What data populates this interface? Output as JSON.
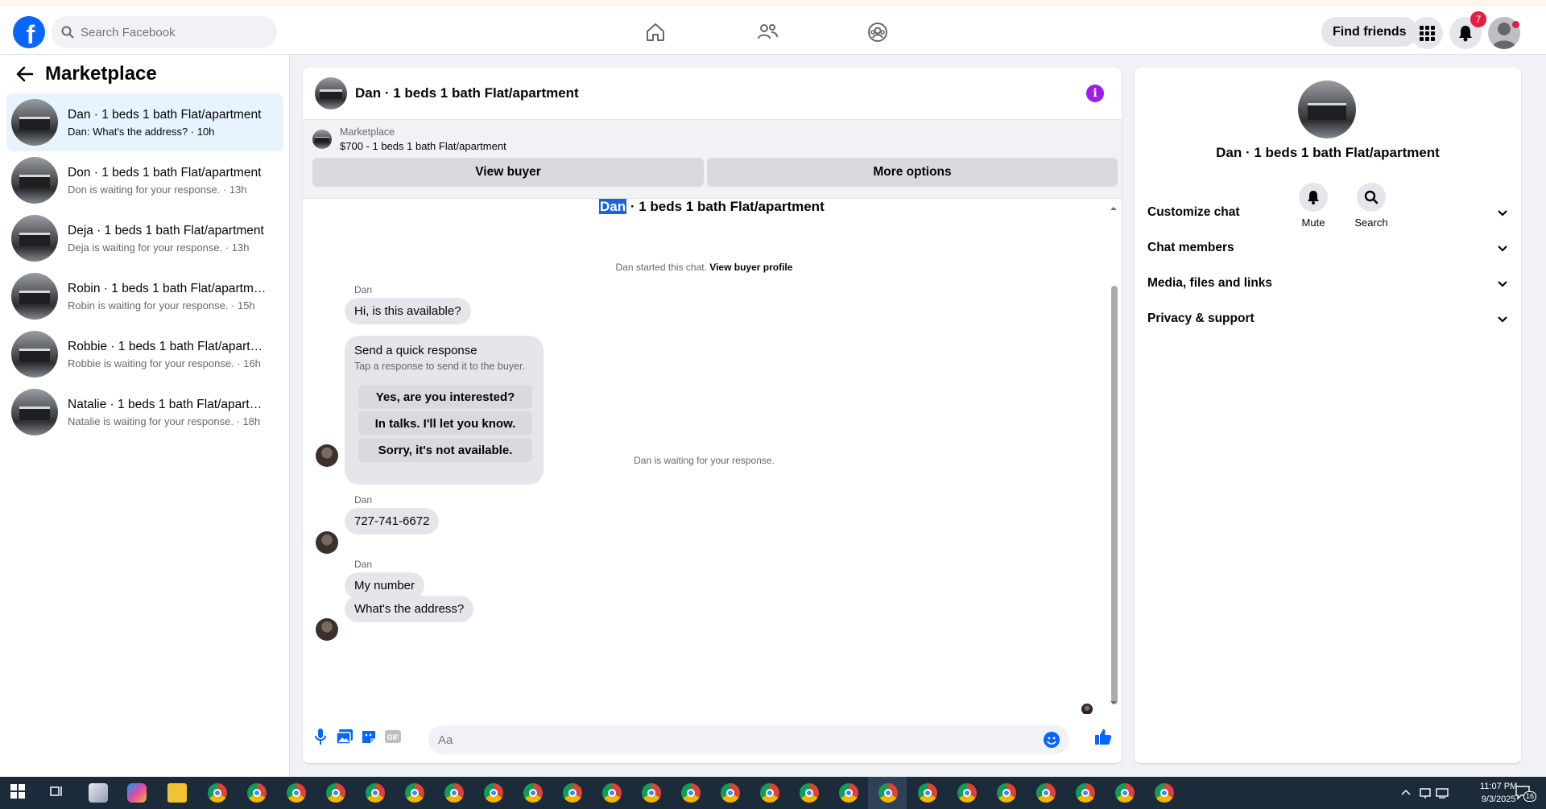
{
  "navbar": {
    "logo": "f",
    "search_placeholder": "Search Facebook",
    "find_friends": "Find friends",
    "notification_count": "7"
  },
  "sidebar": {
    "title": "Marketplace",
    "conversations": [
      {
        "title": "Dan · 1 beds 1 bath Flat/apartment",
        "subtitle": "Dan: What's the address? · 10h",
        "active": true
      },
      {
        "title": "Don · 1 beds 1 bath Flat/apartment",
        "subtitle": "Don is waiting for your response. · 13h"
      },
      {
        "title": "Deja · 1 beds 1 bath Flat/apartment",
        "subtitle": "Deja is waiting for your response. · 13h"
      },
      {
        "title": "Robin · 1 beds 1 bath Flat/apartment",
        "subtitle": "Robin is waiting for your response. · 15h"
      },
      {
        "title": "Robbie · 1 beds 1 bath Flat/apartm...",
        "subtitle": "Robbie is waiting for your response. · 16h"
      },
      {
        "title": "Natalie · 1 beds 1 bath Flat/apartm...",
        "subtitle": "Natalie is waiting for your response. · 18h"
      }
    ]
  },
  "chat": {
    "header_title": "Dan · 1 beds 1 bath Flat/apartment",
    "listing_label": "Marketplace",
    "listing_price": "$700 - 1 beds 1 bath Flat/apartment",
    "view_buyer": "View buyer",
    "more_options": "More options",
    "thread_title_highlight": "Dan",
    "thread_title_rest": " · 1 beds 1 bath Flat/apartment",
    "started_note": "Dan started this chat.",
    "view_buyer_profile": "View buyer profile",
    "sender_name": "Dan",
    "msg_available": "Hi, is this available?",
    "quick_title": "Send a quick response",
    "quick_sub": "Tap a response to send it to the buyer.",
    "quick_responses": [
      "Yes, are you interested?",
      "In talks. I'll let you know.",
      "Sorry, it's not available."
    ],
    "waiting_note": "Dan is waiting for your response.",
    "msg_phone": "727-741-6672",
    "msg_number": "My number",
    "msg_address": "What's the address?",
    "composer_placeholder": "Aa"
  },
  "info_panel": {
    "name": "Dan · 1 beds 1 bath Flat/apartment",
    "mute": "Mute",
    "search": "Search",
    "rows": [
      "Customize chat",
      "Chat members",
      "Media, files and links",
      "Privacy & support"
    ]
  },
  "taskbar": {
    "time": "11:07 PM",
    "date": "9/3/2025",
    "notif_count": "16"
  },
  "colors": {
    "brand": "#0866ff",
    "active_conversation": "#e7f3ff",
    "info_icon": "#9b1fe8",
    "badge": "#e41e3f"
  }
}
